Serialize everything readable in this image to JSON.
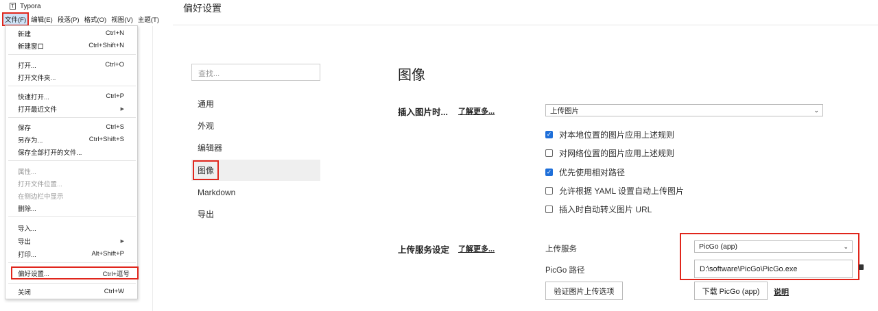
{
  "app": {
    "title": "Typora"
  },
  "menubar": [
    "文件(F)",
    "编辑(E)",
    "段落(P)",
    "格式(O)",
    "视图(V)",
    "主题(T)"
  ],
  "file_menu": [
    {
      "label": "新建",
      "shortcut": "Ctrl+N"
    },
    {
      "label": "新建窗口",
      "shortcut": "Ctrl+Shift+N"
    },
    {
      "label": "打开...",
      "shortcut": "Ctrl+O"
    },
    {
      "label": "打开文件夹...",
      "shortcut": ""
    },
    {
      "label": "快速打开...",
      "shortcut": "Ctrl+P"
    },
    {
      "label": "打开最近文件",
      "shortcut": ""
    },
    {
      "label": "保存",
      "shortcut": "Ctrl+S"
    },
    {
      "label": "另存为...",
      "shortcut": "Ctrl+Shift+S"
    },
    {
      "label": "保存全部打开的文件...",
      "shortcut": ""
    },
    {
      "label": "属性...",
      "shortcut": ""
    },
    {
      "label": "打开文件位置...",
      "shortcut": ""
    },
    {
      "label": "在侧边栏中显示",
      "shortcut": ""
    },
    {
      "label": "删除...",
      "shortcut": ""
    },
    {
      "label": "导入...",
      "shortcut": ""
    },
    {
      "label": "导出",
      "shortcut": ""
    },
    {
      "label": "打印...",
      "shortcut": "Alt+Shift+P"
    },
    {
      "label": "偏好设置...",
      "shortcut": "Ctrl+逗号"
    },
    {
      "label": "关闭",
      "shortcut": "Ctrl+W"
    }
  ],
  "prefs": {
    "window_title": "偏好设置",
    "search_placeholder": "查找...",
    "nav": [
      "通用",
      "外观",
      "编辑器",
      "图像",
      "Markdown",
      "导出"
    ],
    "section_title": "图像",
    "insert_image": {
      "label": "插入图片时...",
      "learn_more": "了解更多...",
      "selected": "上传图片"
    },
    "checkboxes": [
      {
        "label": "对本地位置的图片应用上述规则",
        "checked": true
      },
      {
        "label": "对网络位置的图片应用上述规则",
        "checked": false
      },
      {
        "label": "优先使用相对路径",
        "checked": true
      },
      {
        "label": "允许根据 YAML 设置自动上传图片",
        "checked": false
      },
      {
        "label": "插入时自动转义图片 URL",
        "checked": false
      }
    ],
    "upload": {
      "label": "上传服务设定",
      "learn_more": "了解更多...",
      "service_label": "上传服务",
      "service_value": "PicGo (app)",
      "path_label": "PicGo 路径",
      "path_value": "D:\\software\\PicGo\\PicGo.exe",
      "verify_button": "验证图片上传选项",
      "download_button": "下载 PicGo (app)",
      "help_link": "说明"
    }
  }
}
